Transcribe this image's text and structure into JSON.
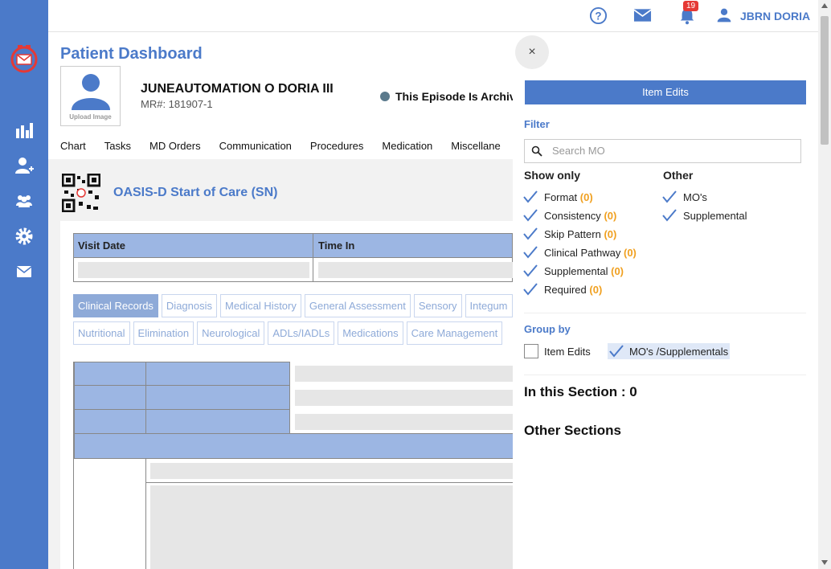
{
  "sidebar": {
    "logo_icon": "clock-envelope-logo",
    "items": [
      {
        "icon": "bar-chart-icon"
      },
      {
        "icon": "user-add-icon"
      },
      {
        "icon": "group-icon"
      },
      {
        "icon": "gear-icon"
      },
      {
        "icon": "mail-icon"
      }
    ]
  },
  "topbar": {
    "help_icon": "help-icon",
    "mail_icon": "mail-icon",
    "bell_icon": "bell-icon",
    "notification_count": "19",
    "user_icon": "user-icon",
    "user_name": "JBRN DORIA"
  },
  "page": {
    "title": "Patient Dashboard",
    "avatar_label": "Upload Image",
    "patient_name": "JUNEAUTOMATION O DORIA III",
    "mr": "MR#: 181907-1",
    "episode_status": "This Episode Is Archive",
    "tabs": [
      "Chart",
      "Tasks",
      "MD Orders",
      "Communication",
      "Procedures",
      "Medication",
      "Miscellane"
    ]
  },
  "form": {
    "title": "OASIS-D Start of Care (SN)",
    "visit_table": {
      "col1": "Visit Date",
      "col2": "Time In"
    },
    "chips_row1": [
      "Clinical Records",
      "Diagnosis",
      "Medical History",
      "General Assessment",
      "Sensory",
      "Integum"
    ],
    "chips_row2": [
      "Nutritional",
      "Elimination",
      "Neurological",
      "ADLs/IADLs",
      "Medications",
      "Care Management"
    ],
    "active_chip": "Clinical Records"
  },
  "panel": {
    "close_label": "×",
    "header": "Item Edits",
    "filter_label": "Filter",
    "search_placeholder": "Search MO",
    "show_only_label": "Show only",
    "show_only": [
      {
        "label": "Format",
        "count": "(0)"
      },
      {
        "label": "Consistency",
        "count": "(0)"
      },
      {
        "label": "Skip Pattern",
        "count": "(0)"
      },
      {
        "label": "Clinical Pathway",
        "count": "(0)"
      },
      {
        "label": "Supplemental",
        "count": "(0)"
      },
      {
        "label": "Required",
        "count": "(0)"
      }
    ],
    "other_label": "Other",
    "other": [
      {
        "label": "MO's"
      },
      {
        "label": "Supplemental"
      }
    ],
    "group_by_label": "Group by",
    "group_item_edits": "Item Edits",
    "group_mos": "MO's /Supplementals",
    "in_section": "In this Section : 0",
    "other_sections": "Other Sections"
  },
  "colors": {
    "brand": "#4b7ac9",
    "table_header": "#9cb6e3",
    "count": "#f0a020",
    "badge": "#e53935"
  }
}
